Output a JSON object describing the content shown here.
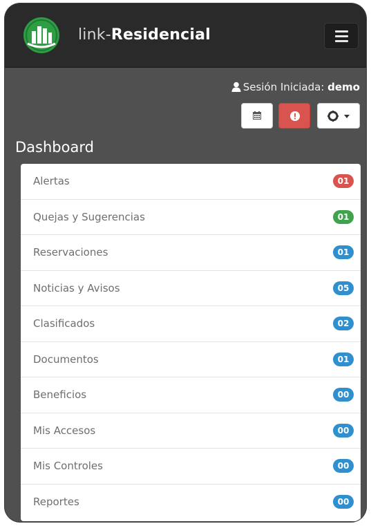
{
  "header": {
    "brand_prefix": "link-",
    "brand_name": "Residencial"
  },
  "session": {
    "label": "Sesión Iniciada:",
    "user": "demo"
  },
  "dashboard": {
    "title": "Dashboard",
    "items": [
      {
        "label": "Alertas",
        "count": "01",
        "color": "#d9534f"
      },
      {
        "label": "Quejas y Sugerencias",
        "count": "01",
        "color": "#3fa34d"
      },
      {
        "label": "Reservaciones",
        "count": "01",
        "color": "#2f8fcf"
      },
      {
        "label": "Noticias y Avisos",
        "count": "05",
        "color": "#2f8fcf"
      },
      {
        "label": "Clasificados",
        "count": "02",
        "color": "#2f8fcf"
      },
      {
        "label": "Documentos",
        "count": "01",
        "color": "#2f8fcf"
      },
      {
        "label": "Beneficios",
        "count": "00",
        "color": "#2f8fcf"
      },
      {
        "label": "Mis Accesos",
        "count": "00",
        "color": "#2f8fcf"
      },
      {
        "label": "Mis Controles",
        "count": "00",
        "color": "#2f8fcf"
      },
      {
        "label": "Reportes",
        "count": "00",
        "color": "#2f8fcf"
      }
    ]
  },
  "colors": {
    "navbar": "#2a2a2a",
    "background": "#505050",
    "logo_green": "#2e9e45",
    "alert_button": "#d9534f"
  },
  "icons": {
    "logo": "building-logo-icon",
    "menu": "hamburger-icon",
    "user": "user-icon",
    "calendar": "calendar-icon",
    "alert": "exclamation-icon",
    "settings": "gear-icon",
    "caret": "caret-down-icon"
  }
}
